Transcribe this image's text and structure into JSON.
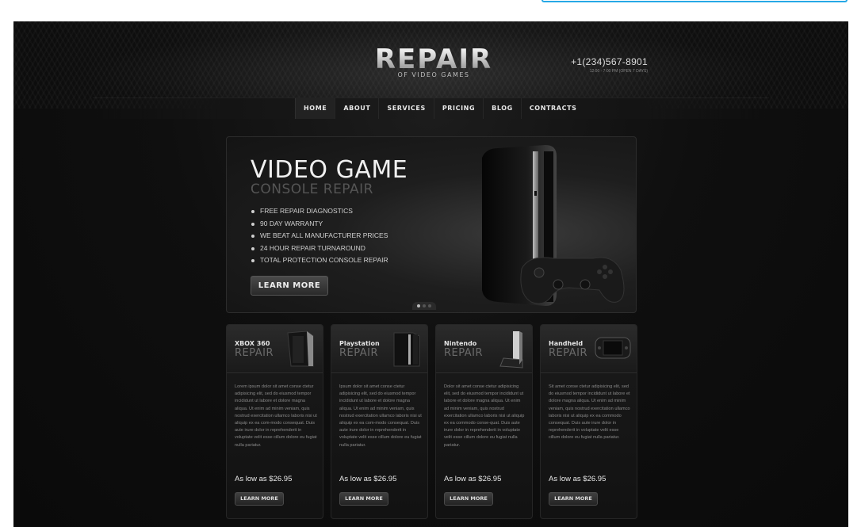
{
  "logo": {
    "main": "REPAIR",
    "sub": "OF VIDEO GAMES"
  },
  "contact": {
    "phone": "+1(234)567-8901",
    "hours": "12:00 - 7:00 PM (OPEN 7 DAYS)"
  },
  "nav": {
    "items": [
      "HOME",
      "ABOUT",
      "SERVICES",
      "PRICING",
      "BLOG",
      "CONTRACTS"
    ],
    "active": "HOME"
  },
  "hero": {
    "title": "VIDEO GAME",
    "subtitle": "CONSOLE REPAIR",
    "bullets": [
      "FREE REPAIR DIAGNOSTICS",
      "90 DAY WARRANTY",
      "WE BEAT ALL MANUFACTURER PRICES",
      "24 HOUR REPAIR TURNAROUND",
      "TOTAL PROTECTION CONSOLE REPAIR"
    ],
    "button": "LEARN MORE",
    "slide_count": 3,
    "active_slide": 1
  },
  "cards": [
    {
      "name": "XBOX 360",
      "repair": "REPAIR",
      "text": "Lorem ipsum dolor sit amet conse ctetur adipisicing elit, sed do eiusmod tempor incididunt ut labore et dolore magna aliqua. Ut enim ad minim veniam, quis nostrud exercitation ullamco laboris nisi ut aliquip ex ea com-modo consequat. Duis aute irure dolor in reprehenderit in voluptate velit esse cillum dolore eu fugiat nulla pariatur.",
      "price": "As low as $26.95",
      "button": "LEARN MORE"
    },
    {
      "name": "Playstation",
      "repair": "REPAIR",
      "text": "Ipsum dolor sit amet conse ctetur adipisicing elit, sed do eiusmod tempor incididunt ut labore et dolore magna aliqua. Ut enim ad minim veniam, quis nostrud exercitation ullamco laboris nisi ut aliquip ex ea com-modo consequat. Duis aute irure dolor in reprehenderit in voluptate velit esse cillum dolore eu fugiat nulla pariatur.",
      "price": "As low as $26.95",
      "button": "LEARN MORE"
    },
    {
      "name": "Nintendo",
      "repair": "REPAIR",
      "text": "Dolor sit amet conse ctetur adipisicing elit, sed do eiusmod tempor incididunt ut labore et dolore magna aliqua. Ut enim ad minim veniam, quis nostrud exercitation ullamco laboris nisi ut aliquip ex ea commodo conse-quat. Duis aute irure dolor in reprehenderit in voluptate velit esse cillum dolore eu fugiat nulla pariatur.",
      "price": "As low as $26.95",
      "button": "LEARN MORE"
    },
    {
      "name": "Handheld",
      "repair": "REPAIR",
      "text": "Sit amet conse ctetur adipisicing elit, sed do eiusmod tempor incididunt ut labore et dolore magna aliqua. Ut enim ad minim veniam, quis nostrud exercitation ullamco laboris nisi ut aliquip ex ea commodo consequat. Duis aute irure dolor in reprehenderit in voluptate velit esse cillum dolore eu fugiat nulla pariatur.",
      "price": "As low as $26.95",
      "button": "LEARN MORE"
    }
  ],
  "icons": {
    "console": "console-image",
    "gamepad": "gamepad-image"
  },
  "colors": {
    "accent_border": "#27a8e6",
    "background": "#0f0f0f"
  }
}
